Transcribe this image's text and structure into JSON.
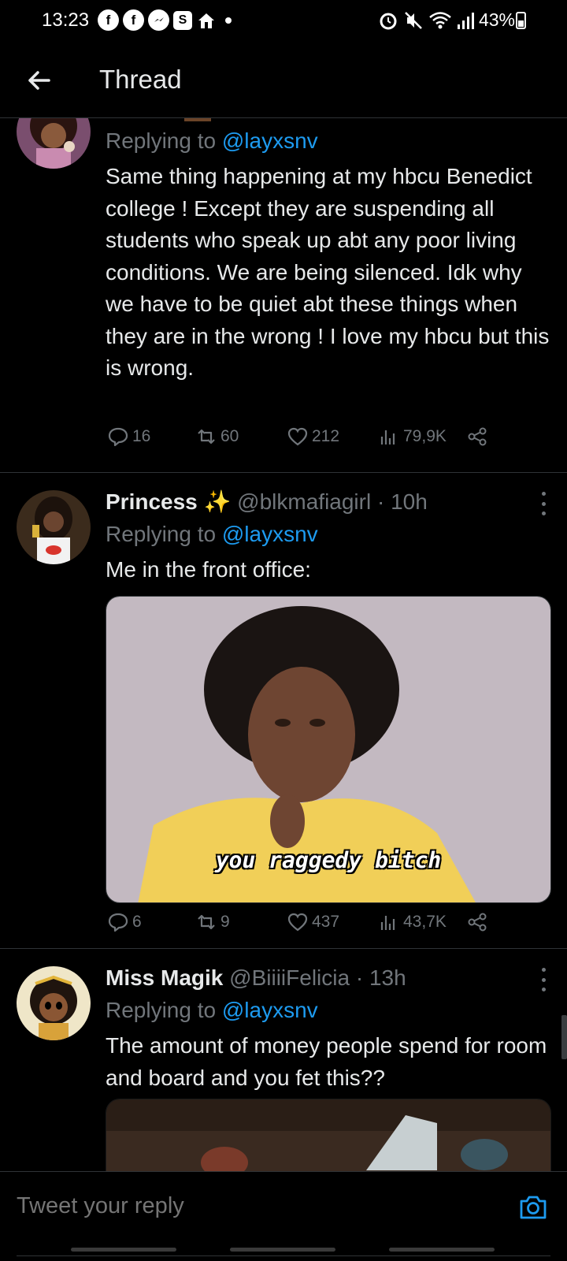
{
  "status_bar": {
    "time": "13:23",
    "left_icons": [
      "facebook-icon",
      "facebook-icon",
      "messenger-icon",
      "s-icon",
      "home-icon"
    ],
    "right_icons": [
      "alarm-icon",
      "mute-icon",
      "wifi-icon",
      "signal-icon"
    ],
    "battery": "43%"
  },
  "header": {
    "title": "Thread"
  },
  "tweets": [
    {
      "replying_prefix": "Replying to",
      "replying_to": "@layxsnv",
      "text": "Same thing happening at my hbcu Benedict college ! Except they are suspending all students who speak up abt any poor living conditions. We are being silenced. Idk why we have to be quiet abt these things when they are in the wrong ! I love my hbcu but this is wrong.",
      "replies": "16",
      "retweets": "60",
      "likes": "212",
      "views": "79,9K"
    },
    {
      "name": "Princess ✨",
      "handle": "@blkmafiagirl · 10h",
      "replying_prefix": "Replying to",
      "replying_to": "@layxsnv",
      "text": "Me in the front office:",
      "media_caption": "you raggedy bitch",
      "replies": "6",
      "retweets": "9",
      "likes": "437",
      "views": "43,7K"
    },
    {
      "name": "Miss Magik",
      "handle": "@BiiiiFelicia · 13h",
      "replying_prefix": "Replying to",
      "replying_to": "@layxsnv",
      "text": "The amount of money people spend for room and board and you fet this??"
    }
  ],
  "reply_bar": {
    "placeholder": "Tweet your reply"
  },
  "colors": {
    "background": "#000000",
    "accent": "#1d9bf0",
    "muted": "#71767b",
    "divider": "#2f3336"
  }
}
